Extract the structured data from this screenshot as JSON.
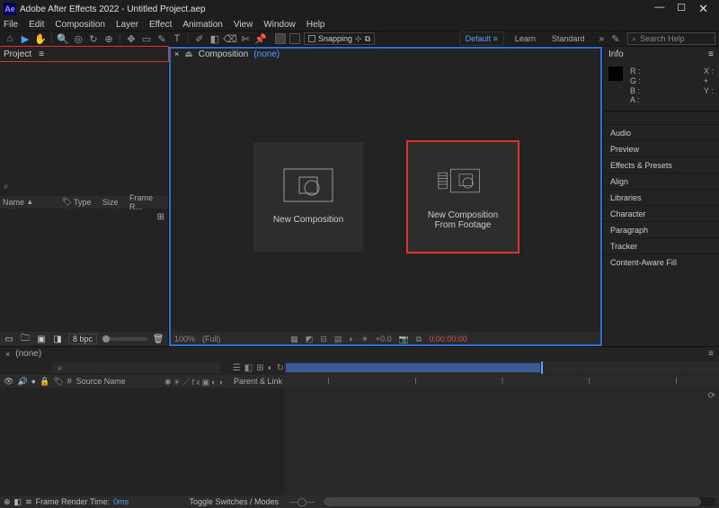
{
  "title": {
    "app_label": "Ae",
    "text": "Adobe After Effects 2022 - Untitled Project.aep"
  },
  "menubar": [
    "File",
    "Edit",
    "Composition",
    "Layer",
    "Effect",
    "Animation",
    "View",
    "Window",
    "Help"
  ],
  "toolbar": {
    "snapping_label": "Snapping",
    "workspaces": [
      "Default",
      "Learn",
      "Standard"
    ],
    "active_workspace": 0,
    "search_placeholder": "Search Help"
  },
  "project": {
    "tab_label": "Project",
    "columns": {
      "name": "Name",
      "type": "Type",
      "size": "Size",
      "frame": "Frame R..."
    },
    "bpc": "8 bpc"
  },
  "composition": {
    "tab_label": "Composition",
    "comp_name": "(none)",
    "card_new": "New Composition",
    "card_from_footage_l1": "New Composition",
    "card_from_footage_l2": "From Footage",
    "footer": {
      "zoom": "100%",
      "quality": "(Full)",
      "time": "0:00:00:00",
      "fps": "+0.0"
    }
  },
  "info": {
    "tab_label": "Info",
    "rgba": [
      "R :",
      "G :",
      "B :",
      "A :"
    ],
    "xy": [
      "X :",
      "Y :"
    ],
    "panels": [
      "Audio",
      "Preview",
      "Effects & Presets",
      "Align",
      "Libraries",
      "Character",
      "Paragraph",
      "Tracker",
      "Content-Aware Fill"
    ]
  },
  "timeline": {
    "tab_label": "(none)",
    "source_name": "Source Name",
    "parent_link": "Parent & Link",
    "render_label": "Frame Render Time:",
    "render_time": "0ms",
    "toggle_label": "Toggle Switches / Modes"
  }
}
